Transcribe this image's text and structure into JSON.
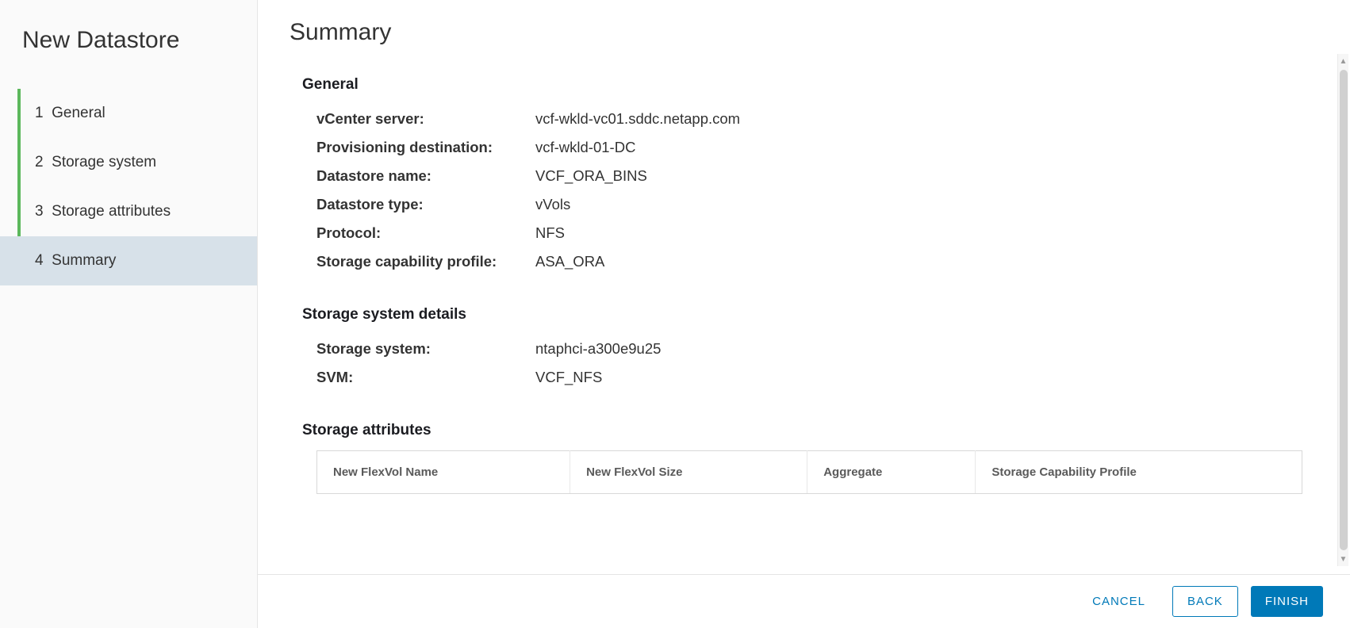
{
  "wizard": {
    "title": "New Datastore",
    "steps": [
      {
        "num": "1",
        "label": "General"
      },
      {
        "num": "2",
        "label": "Storage system"
      },
      {
        "num": "3",
        "label": "Storage attributes"
      },
      {
        "num": "4",
        "label": "Summary"
      }
    ]
  },
  "page": {
    "title": "Summary"
  },
  "sections": {
    "general": {
      "heading": "General",
      "rows": {
        "vcenter_label": "vCenter server:",
        "vcenter_value": "vcf-wkld-vc01.sddc.netapp.com",
        "provdest_label": "Provisioning destination:",
        "provdest_value": "vcf-wkld-01-DC",
        "dsname_label": "Datastore name:",
        "dsname_value": "VCF_ORA_BINS",
        "dstype_label": "Datastore type:",
        "dstype_value": "vVols",
        "protocol_label": "Protocol:",
        "protocol_value": "NFS",
        "scp_label": "Storage capability profile:",
        "scp_value": "ASA_ORA"
      }
    },
    "storage_system": {
      "heading": "Storage system details",
      "rows": {
        "system_label": "Storage system:",
        "system_value": "ntaphci-a300e9u25",
        "svm_label": "SVM:",
        "svm_value": "VCF_NFS"
      }
    },
    "storage_attrs": {
      "heading": "Storage attributes",
      "columns": {
        "c1": "New FlexVol Name",
        "c2": "New FlexVol Size",
        "c3": "Aggregate",
        "c4": "Storage Capability Profile"
      }
    }
  },
  "footer": {
    "cancel": "CANCEL",
    "back": "BACK",
    "finish": "FINISH"
  }
}
